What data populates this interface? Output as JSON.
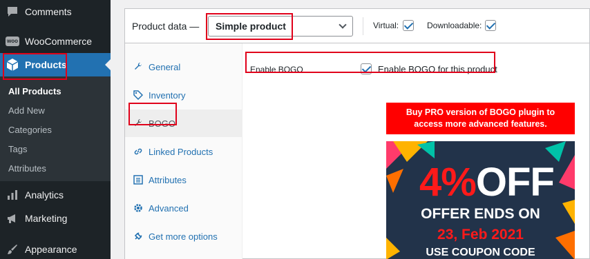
{
  "sidebar": {
    "items": [
      {
        "label": "Comments",
        "icon": "comment-icon"
      },
      {
        "label": "WooCommerce",
        "icon": "woocommerce-icon",
        "icon_text": "woo"
      },
      {
        "label": "Products",
        "icon": "products-icon"
      },
      {
        "label": "Analytics",
        "icon": "analytics-icon"
      },
      {
        "label": "Marketing",
        "icon": "megaphone-icon"
      },
      {
        "label": "Appearance",
        "icon": "paintbrush-icon"
      }
    ],
    "submenu": [
      "All Products",
      "Add New",
      "Categories",
      "Tags",
      "Attributes"
    ]
  },
  "product_data": {
    "title": "Product data —",
    "type_select": "Simple product",
    "virtual_label": "Virtual:",
    "virtual_checked": true,
    "downloadable_label": "Downloadable:",
    "downloadable_checked": true
  },
  "tabs": [
    {
      "label": "General",
      "icon": "wrench-icon"
    },
    {
      "label": "Inventory",
      "icon": "tag-icon"
    },
    {
      "label": "BOGO",
      "icon": "wrench-icon"
    },
    {
      "label": "Linked Products",
      "icon": "link-icon"
    },
    {
      "label": "Attributes",
      "icon": "list-icon"
    },
    {
      "label": "Advanced",
      "icon": "gear-icon"
    },
    {
      "label": "Get more options",
      "icon": "plugin-icon"
    }
  ],
  "bogo": {
    "field_label": "Enable BOGO",
    "checkbox_checked": true,
    "checkbox_desc": "Enable BOGO for this product",
    "promo_text": "Buy PRO version of BOGO plugin to access more advanced features.",
    "promo_image": {
      "discount_number": "4%",
      "discount_word": "OFF",
      "offer_line": "OFFER ENDS ON",
      "date_line": "23, Feb 2021",
      "coupon_line": "USE COUPON CODE"
    }
  },
  "colors": {
    "admin_sidebar": "#1d2327",
    "accent": "#2271b1",
    "annotation": "#e0001a",
    "promo_red": "#ff0000",
    "promo_bg": "#22334a"
  }
}
